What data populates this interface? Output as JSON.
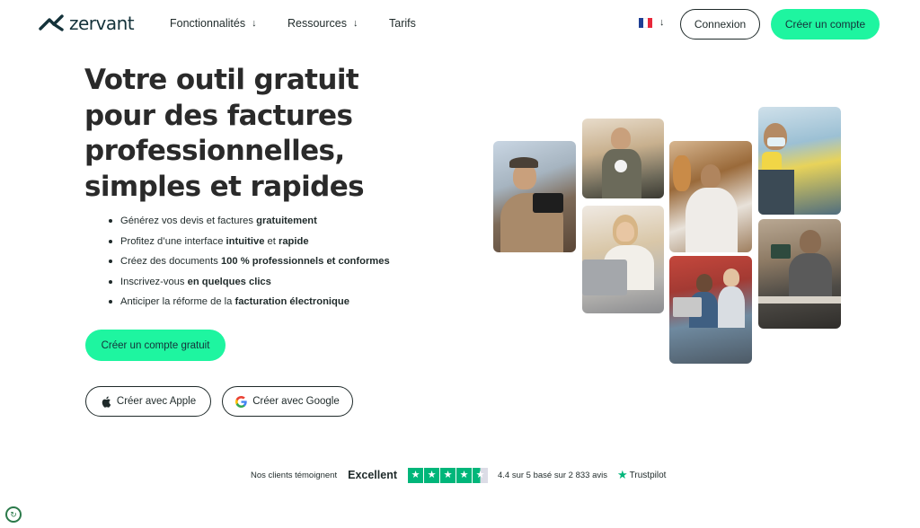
{
  "brand": {
    "name": "zervant",
    "color": "#14323a",
    "accent": "#1ef5a0"
  },
  "nav": {
    "items": [
      {
        "label": "Fonctionnalités",
        "arrow": "↓"
      },
      {
        "label": "Ressources",
        "arrow": "↓"
      },
      {
        "label": "Tarifs"
      }
    ],
    "lang_arrow": "↓",
    "login_label": "Connexion",
    "signup_label": "Créer un compte"
  },
  "hero": {
    "title": "Votre outil gratuit pour des factures professionnelles, simples et rapides",
    "bullets": [
      {
        "pre": "Générez vos devis et factures ",
        "b1": "gratuitement",
        "mid": "",
        "b2": ""
      },
      {
        "pre": "Profitez d’une interface ",
        "b1": "intuitive",
        "mid": " et ",
        "b2": "rapide"
      },
      {
        "pre": "Créez des documents ",
        "b1": "100 % professionnels et conformes",
        "mid": "",
        "b2": ""
      },
      {
        "pre": "Inscrivez-vous ",
        "b1": "en quelques clics",
        "mid": "",
        "b2": ""
      },
      {
        "pre": "Anticiper la réforme de la ",
        "b1": "facturation électronique",
        "mid": "",
        "b2": ""
      }
    ],
    "cta_label": "Créer un compte gratuit",
    "apple_label": "Créer avec Apple",
    "google_label": "Créer avec Google"
  },
  "trust": {
    "intro": "Nos clients témoignent",
    "rating_word": "Excellent",
    "stars": 4.5,
    "summary": "4.4 sur 5 basé sur 2 833 avis",
    "provider": "Trustpilot",
    "provider_color": "#00b67a"
  },
  "icons": {
    "logo": "zervant-logo-icon",
    "flag": "france-flag-icon",
    "apple": "apple-icon",
    "google": "google-icon",
    "star": "trustpilot-star-icon",
    "badge": "recaptcha-icon"
  }
}
